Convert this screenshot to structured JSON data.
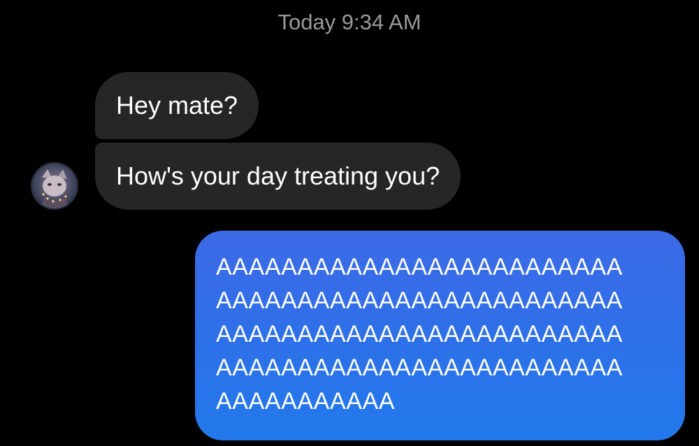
{
  "conversation": {
    "timestamp": "Today 9:34 AM",
    "incoming": [
      {
        "text": "Hey mate?"
      },
      {
        "text": "How's your day treating you?"
      }
    ],
    "outgoing": {
      "text": "AAAAAAAAAAAAAAAAAAAAAAAAA\nAAAAAAAAAAAAAAAAAAAAAAAAA\nAAAAAAAAAAAAAAAAAAAAAAAAA\nAAAAAAAAAAAAAAAAAAAAAAAAA\nAAAAAAAAAAA"
    },
    "avatar": {
      "icon": "contact-avatar-icon"
    }
  },
  "colors": {
    "background": "#000000",
    "incoming_bubble": "#262626",
    "outgoing_bubble": "#2f6fe8",
    "timestamp_text": "#9a9a9a"
  }
}
